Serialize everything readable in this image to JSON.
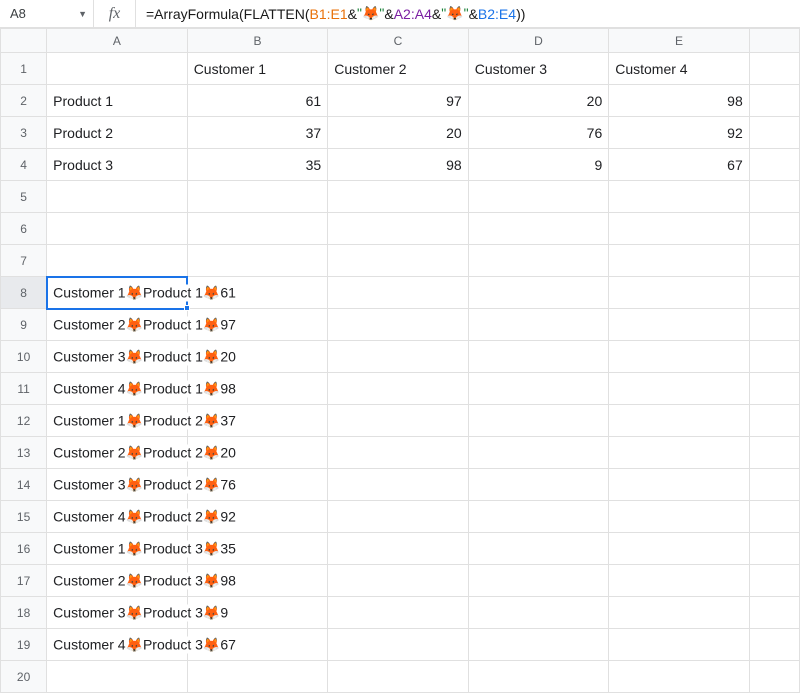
{
  "nameBox": {
    "cellRef": "A8"
  },
  "formula": {
    "prefix": "=ArrayFormula",
    "open": "(",
    "flatten": "FLATTEN",
    "open2": "(",
    "range1": "B1:E1",
    "amp1": "&",
    "str1": "\"🦊\"",
    "amp2": "&",
    "range2": "A2:A4",
    "amp3": "&",
    "str2": "\"🦊\"",
    "amp4": "&",
    "range3": "B2:E4",
    "close": "))"
  },
  "columns": [
    "A",
    "B",
    "C",
    "D",
    "E",
    ""
  ],
  "rowCount": 20,
  "dataTable": {
    "rows": [
      {
        "r": 1,
        "cells": [
          "",
          "Customer 1",
          "Customer 2",
          "Customer 3",
          "Customer 4",
          ""
        ]
      },
      {
        "r": 2,
        "cells": [
          "Product 1",
          61,
          97,
          20,
          98,
          ""
        ]
      },
      {
        "r": 3,
        "cells": [
          "Product 2",
          37,
          20,
          76,
          92,
          ""
        ]
      },
      {
        "r": 4,
        "cells": [
          "Product 3",
          35,
          98,
          9,
          67,
          ""
        ]
      }
    ]
  },
  "flatResults": [
    "Customer 1🦊Product 1🦊61",
    "Customer 2🦊Product 1🦊97",
    "Customer 3🦊Product 1🦊20",
    "Customer 4🦊Product 1🦊98",
    "Customer 1🦊Product 2🦊37",
    "Customer 2🦊Product 2🦊20",
    "Customer 3🦊Product 2🦊76",
    "Customer 4🦊Product 2🦊92",
    "Customer 1🦊Product 3🦊35",
    "Customer 2🦊Product 3🦊98",
    "Customer 3🦊Product 3🦊9",
    "Customer 4🦊Product 3🦊67"
  ],
  "selection": {
    "row": 8,
    "col": "A"
  }
}
